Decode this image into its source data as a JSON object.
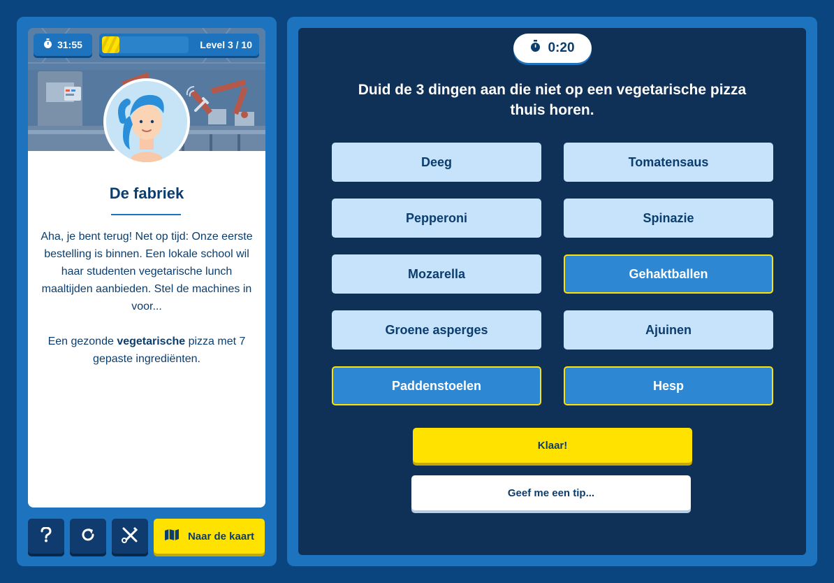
{
  "status": {
    "elapsed_time": "31:55",
    "level_label": "Level 3 / 10",
    "level_progress_fraction": 0.2
  },
  "story": {
    "title": "De fabriek",
    "paragraph1": "Aha, je bent terug! Net op tijd: Onze eerste bestelling is binnen. Een lokale school wil haar studenten vegetarische lunch maaltijden aanbieden. Stel de machines in voor...",
    "paragraph2_before": "Een gezonde ",
    "paragraph2_bold": "vegetarische",
    "paragraph2_after": " pizza met 7 gepaste ingrediënten."
  },
  "toolbar": {
    "help_icon": "question-mark-icon",
    "restart_icon": "restart-icon",
    "tools_icon": "crossed-tools-icon",
    "map_icon": "map-icon",
    "map_label": "Naar de kaart"
  },
  "quiz": {
    "countdown": "0:20",
    "question": "Duid de 3 dingen aan die niet op een vegetarische pizza thuis horen.",
    "options": [
      {
        "label": "Deeg",
        "selected": false
      },
      {
        "label": "Tomatensaus",
        "selected": false
      },
      {
        "label": "Pepperoni",
        "selected": false
      },
      {
        "label": "Spinazie",
        "selected": false
      },
      {
        "label": "Mozarella",
        "selected": false
      },
      {
        "label": "Gehaktballen",
        "selected": true
      },
      {
        "label": "Groene asperges",
        "selected": false
      },
      {
        "label": "Ajuinen",
        "selected": false
      },
      {
        "label": "Paddenstoelen",
        "selected": true
      },
      {
        "label": "Hesp",
        "selected": true
      }
    ],
    "done_label": "Klaar!",
    "tip_label": "Geef me een tip..."
  },
  "colors": {
    "background": "#0b4580",
    "panel_blue": "#1d73bd",
    "dark_navy": "#0f3158",
    "option_light": "#c6e3fb",
    "option_selected": "#2d87d3",
    "accent_yellow": "#ffe200"
  }
}
